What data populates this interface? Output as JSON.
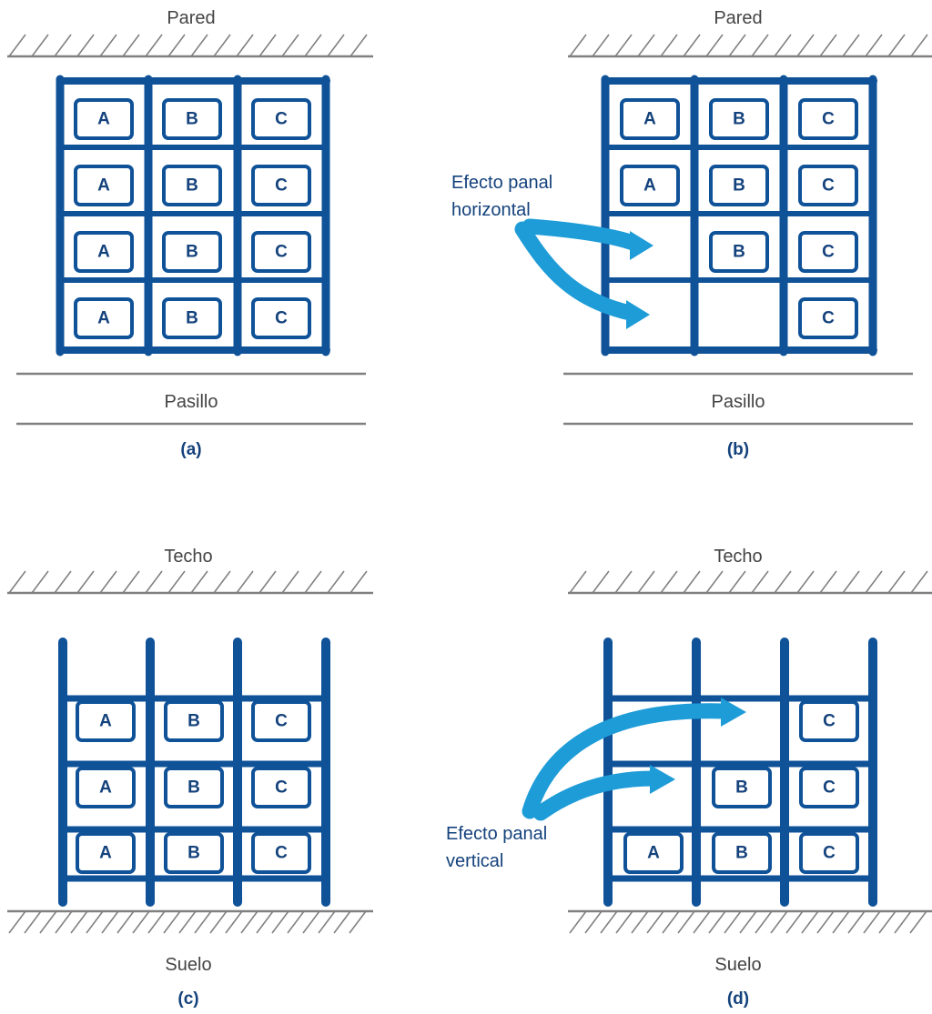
{
  "figure": {
    "colors": {
      "rack_blue": "#0F5298",
      "arrow_cyan": "#1E9CD8",
      "boundary_gray": "#808080",
      "label_gray": "#444444",
      "caption_blue": "#14427c",
      "background": "#ffffff"
    }
  },
  "panels": [
    {
      "id": "a",
      "caption": "(a)",
      "orientation": "horizontal",
      "top_label": "Pared",
      "bottom_label": "Pasillo",
      "columns": [
        "A",
        "B",
        "C"
      ],
      "rows": 4,
      "cells": [
        [
          "A",
          "B",
          "C"
        ],
        [
          "A",
          "B",
          "C"
        ],
        [
          "A",
          "B",
          "C"
        ],
        [
          "A",
          "B",
          "C"
        ]
      ],
      "annotation": null
    },
    {
      "id": "b",
      "caption": "(b)",
      "orientation": "horizontal",
      "top_label": "Pared",
      "bottom_label": "Pasillo",
      "columns": [
        "A",
        "B",
        "C"
      ],
      "rows": 4,
      "cells": [
        [
          "A",
          "B",
          "C"
        ],
        [
          "A",
          "B",
          "C"
        ],
        [
          "",
          "B",
          "C"
        ],
        [
          "",
          "",
          "C"
        ]
      ],
      "annotation": {
        "line1": "Efecto panal",
        "line2": "horizontal",
        "arrows": 2
      }
    },
    {
      "id": "c",
      "caption": "(c)",
      "orientation": "vertical",
      "top_label": "Techo",
      "bottom_label": "Suelo",
      "columns": [
        "A",
        "B",
        "C"
      ],
      "rows": 3,
      "cells": [
        [
          "A",
          "B",
          "C"
        ],
        [
          "A",
          "B",
          "C"
        ],
        [
          "A",
          "B",
          "C"
        ]
      ],
      "annotation": null
    },
    {
      "id": "d",
      "caption": "(d)",
      "orientation": "vertical",
      "top_label": "Techo",
      "bottom_label": "Suelo",
      "columns": [
        "A",
        "B",
        "C"
      ],
      "rows": 3,
      "cells": [
        [
          "",
          "",
          "C"
        ],
        [
          "",
          "B",
          "C"
        ],
        [
          "A",
          "B",
          "C"
        ]
      ],
      "annotation": {
        "line1": "Efecto panal",
        "line2": "vertical",
        "arrows": 2
      }
    }
  ]
}
